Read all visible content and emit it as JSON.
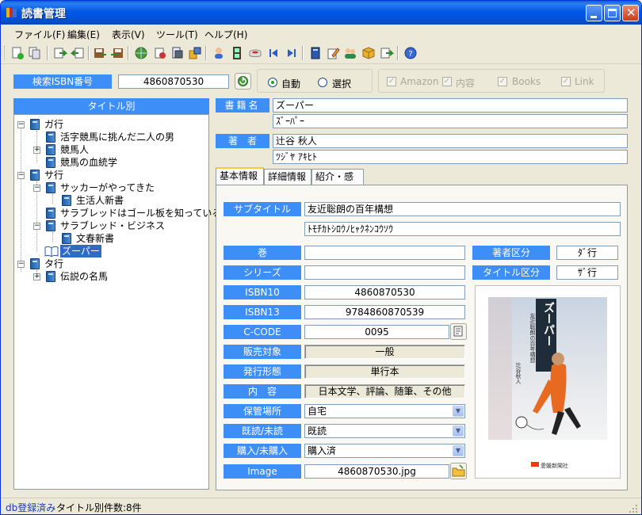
{
  "window": {
    "title": "読書管理"
  },
  "menu": [
    "ファイル(F)",
    "編集(E)",
    "表示(V)",
    "ツール(T)",
    "ヘルプ(H)"
  ],
  "toolbar_icons": [
    "new-icon",
    "copy-icon",
    "import-icon",
    "export-icon",
    "save-icon",
    "load-icon",
    "web-icon",
    "db-icon",
    "print-icon",
    "report-icon",
    "user-icon",
    "film-icon",
    "cup-icon",
    "first-icon",
    "last-icon",
    "book-icon",
    "edit-icon",
    "people-icon",
    "package-icon",
    "update-icon",
    "help-icon"
  ],
  "search": {
    "label": "検索ISBN番号",
    "value": "4860870530",
    "mode_auto": "自動",
    "mode_select": "選択",
    "sources": [
      "Amazon",
      "内容",
      "Books",
      "Link"
    ]
  },
  "tree": {
    "header": "タイトル別",
    "nodes": [
      {
        "label": "ガ行"
      },
      {
        "label": "活字競馬に挑んだ二人の男"
      },
      {
        "label": "競馬人"
      },
      {
        "label": "競馬の血統学"
      },
      {
        "label": "サ行"
      },
      {
        "label": "サッカーがやってきた"
      },
      {
        "label": "生活人新書"
      },
      {
        "label": "サラブレッドはゴール板を知っているか"
      },
      {
        "label": "サラブレッド・ビジネス"
      },
      {
        "label": "文春新書"
      },
      {
        "label": "ズーパー"
      },
      {
        "label": "タ行"
      },
      {
        "label": "伝説の名馬"
      }
    ]
  },
  "book": {
    "title_label": "書籍名",
    "title": "ズーパー",
    "title_kana": "ｽﾞｰﾊﾟｰ",
    "author_label": "著　者",
    "author": "辻谷 秋人",
    "author_kana": "ﾂｼﾞﾔ ｱｷﾋﾄ"
  },
  "tabs": [
    "基本情報",
    "詳細情報",
    "紹介・感想"
  ],
  "detail": {
    "subtitle_label": "サブタイトル",
    "subtitle": "友近聡朗の百年構想",
    "subtitle_kana": "ﾄﾓﾁｶﾄｼﾛｳﾉﾋｬｸﾈﾝｺｳｿｳ",
    "volume_label": "巻",
    "volume": "",
    "series_label": "シリーズ",
    "series": "",
    "author_cat_label": "著者区分",
    "author_cat": "ﾀﾞ行",
    "title_cat_label": "タイトル区分",
    "title_cat": "ｻﾞ行",
    "isbn10_label": "ISBN10",
    "isbn10": "4860870530",
    "isbn13_label": "ISBN13",
    "isbn13": "9784860870539",
    "ccode_label": "C-CODE",
    "ccode": "0095",
    "target_label": "販売対象",
    "target": "一般",
    "form_label": "発行形態",
    "form": "単行本",
    "content_label": "内　容",
    "content": "日本文学、評論、随筆、その他",
    "storage_label": "保管場所",
    "storage": "自宅",
    "read_label": "既読/未読",
    "read": "既読",
    "purchase_label": "購入/未購入",
    "purchase": "購入済",
    "image_label": "Image",
    "image": "4860870530.jpg"
  },
  "cover": {
    "title": "ズーパー",
    "subtitle": "友近聡朗の百年構想",
    "author": "辻谷秋人",
    "publisher": "愛媛新聞社"
  },
  "status": {
    "db": "db登録済み",
    "count": "タイトル別件数:8件"
  }
}
